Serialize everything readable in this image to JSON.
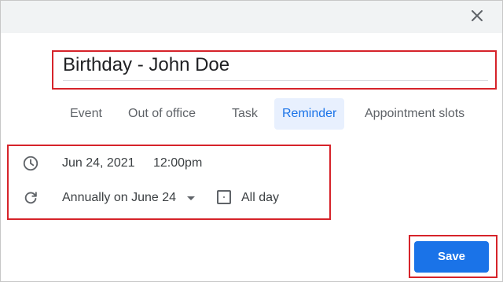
{
  "dialog": {
    "close_icon": "close-icon",
    "title_value": "Birthday - John Doe"
  },
  "tabs": [
    {
      "label": "Event",
      "active": false
    },
    {
      "label": "Out of office",
      "active": false
    },
    {
      "label": "Task",
      "active": false
    },
    {
      "label": "Reminder",
      "active": true
    },
    {
      "label": "Appointment slots",
      "active": false
    }
  ],
  "details": {
    "date": "Jun 24, 2021",
    "time": "12:00pm",
    "recurrence": "Annually on June 24",
    "all_day_label": "All day",
    "all_day_checked": false,
    "clock_icon": "clock-icon",
    "repeat_icon": "repeat-icon"
  },
  "actions": {
    "save_label": "Save"
  },
  "colors": {
    "accent": "#1a73e8",
    "highlight": "#d6232a",
    "active_tab_bg": "#e8f0fe"
  }
}
